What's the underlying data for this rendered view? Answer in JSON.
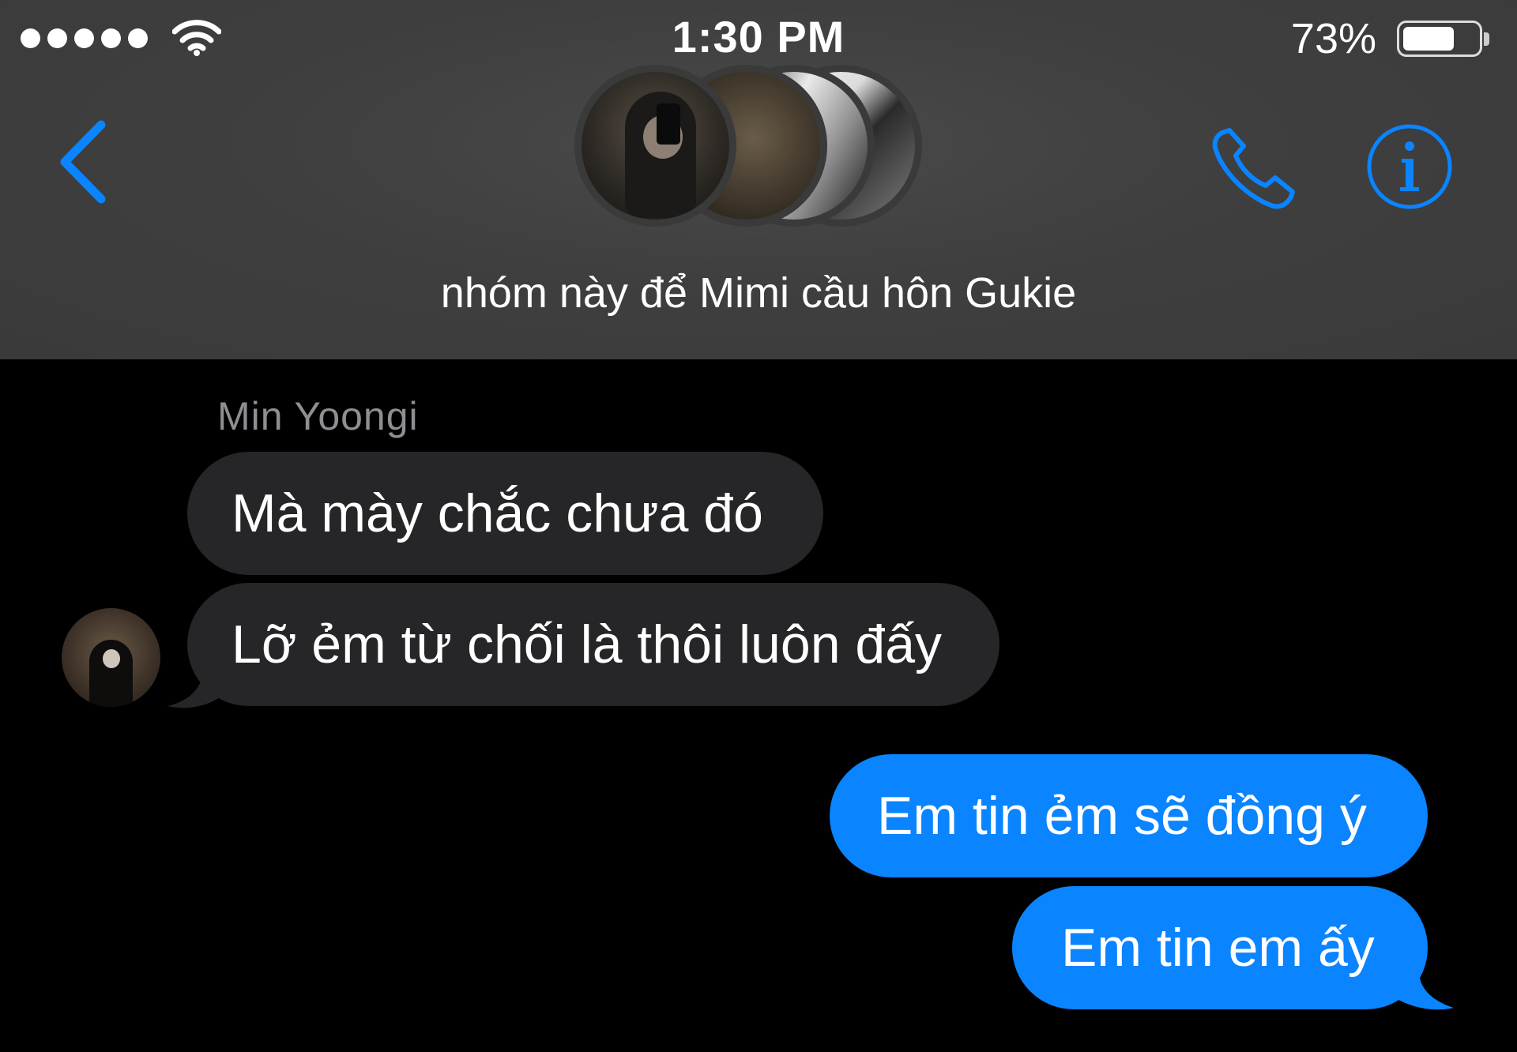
{
  "status_bar": {
    "time": "1:30 PM",
    "battery_percent_label": "73%",
    "battery_level": 0.73,
    "signal_dots": 5
  },
  "header": {
    "group_name": "nhóm này để Mimi cầu hôn Gukie",
    "back_icon": "chevron-left-icon",
    "call_icon": "phone-icon",
    "info_icon": "info-icon",
    "accent_color": "#0a84ff"
  },
  "messages": [
    {
      "sender": "Min Yoongi",
      "text": "Mà mày chắc chưa đó",
      "direction": "incoming"
    },
    {
      "sender": "Min Yoongi",
      "text": "Lỡ ẻm từ chối là thôi luôn đấy",
      "direction": "incoming"
    },
    {
      "text": "Em tin ẻm sẽ đồng ý",
      "direction": "outgoing"
    },
    {
      "text": "Em tin em ấy",
      "direction": "outgoing"
    }
  ],
  "colors": {
    "incoming_bubble": "#262628",
    "outgoing_bubble": "#0a84ff",
    "sender_name": "#8e8e93",
    "header_bg": "#3f3f3f",
    "background": "#000000"
  }
}
